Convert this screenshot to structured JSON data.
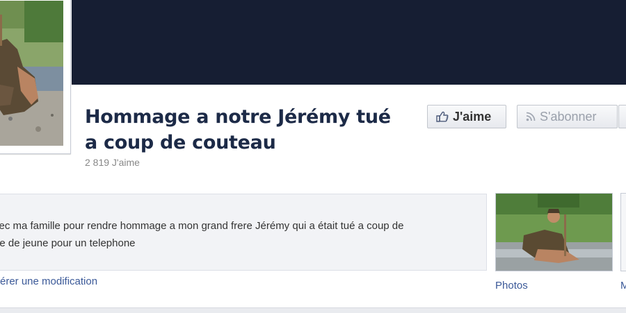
{
  "page": {
    "title_line1": "Hommage a notre Jérémy tué",
    "title_line2": "a coup de couteau",
    "likes_count": "2 819 J'aime"
  },
  "actions": {
    "like_label": "J'aime",
    "subscribe_label": "S'abonner"
  },
  "status": {
    "line1": "vec ma famille pour rendre hommage a mon grand frere Jérémy qui a était tué a coup de",
    "line2": "pe de jeune pour un telephone",
    "suggest_edit": "érer une modification"
  },
  "sidebar": {
    "photos_label": "Photos",
    "more_label": "M"
  },
  "colors": {
    "cover": "#161e33",
    "title": "#1c2a47",
    "link": "#3b5998"
  },
  "icons": {
    "like": "thumbs-up-icon",
    "subscribe": "rss-icon"
  }
}
